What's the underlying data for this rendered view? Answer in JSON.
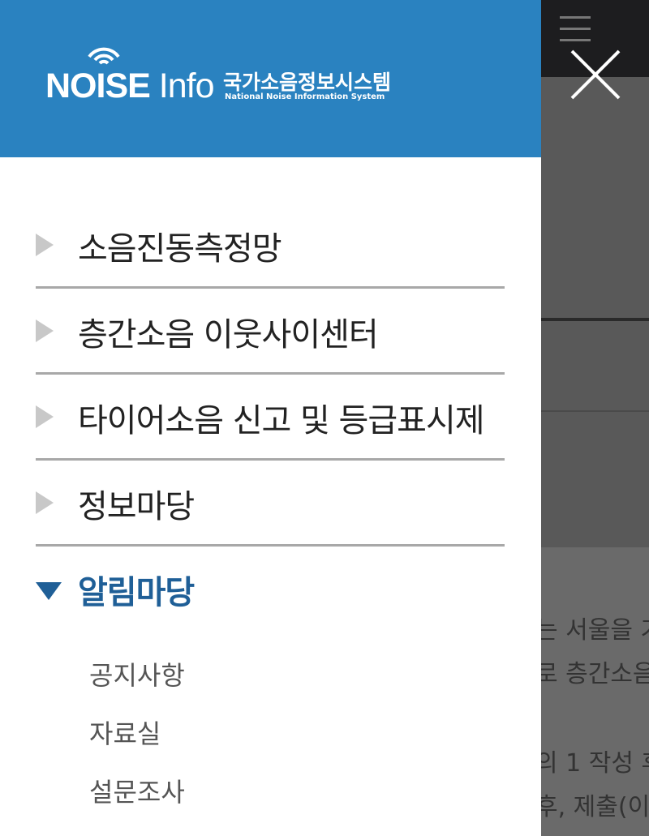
{
  "logo": {
    "wordmark_bold": "NOISE",
    "wordmark_light": "Info",
    "kr_title": "국가소음정보시스템",
    "en_title": "National Noise Information System"
  },
  "menu": [
    {
      "label": "소음진동측정망",
      "expanded": false
    },
    {
      "label": "층간소음 이웃사이센터",
      "expanded": false
    },
    {
      "label": "타이어소음 신고 및 등급표시제",
      "expanded": false
    },
    {
      "label": "정보마당",
      "expanded": false
    },
    {
      "label": "알림마당",
      "expanded": true
    }
  ],
  "submenu": [
    "공지사항",
    "자료실",
    "설문조사"
  ],
  "background_text": [
    "는 서울을 기",
    "로 층간소음",
    "의 1 작성 후",
    "후, 제출(이"
  ],
  "colors": {
    "header_bg": "#2a82c0",
    "active": "#1f5f97",
    "overlay": "#595959"
  },
  "icons": {
    "close": "close-icon",
    "hamburger": "hamburger-icon",
    "collapsed": "triangle-right-icon",
    "expanded": "triangle-down-icon"
  }
}
